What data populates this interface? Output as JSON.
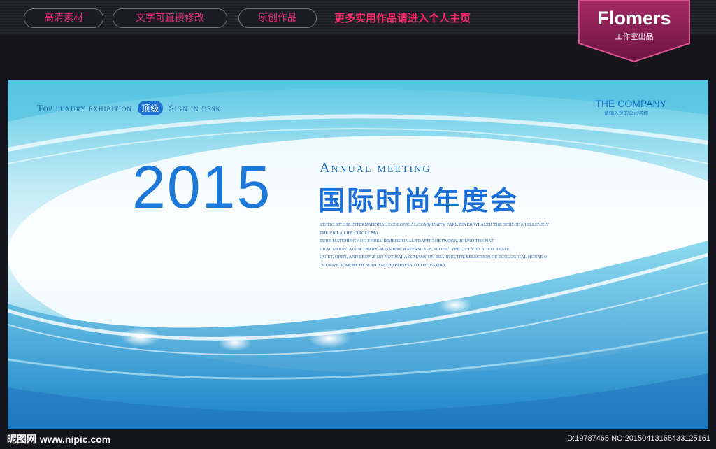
{
  "header": {
    "pills": [
      "高清素材",
      "文字可直接修改",
      "原创作品"
    ],
    "promo": "更多实用作品请进入个人主页",
    "badge_title": "Flomers",
    "badge_subtitle": "工作室出品"
  },
  "banner": {
    "tagline_left": "Top luxury exhibition",
    "tagline_tag": "顶级",
    "tagline_right": "Sign in desk",
    "company": "THE COMPANY",
    "company_sub": "请输入您的公司名称",
    "year": "2015",
    "annual": "Annual meeting",
    "cn_title": "国际时尚年度会",
    "body_lines": [
      "STATIC AT THE INTERNATIONAL ECOLOGICAL COMMUNITY PARK RIVER WEALTH THE SIDE OF A HILLENJOY",
      "THE VILLA LIFE CIRCLE MA",
      "TURE MATCHING AND THREE-DIMENSIONAL TRAFFIC NETWORK,ROUND THE NAT",
      "URAL MOUNTAIN SCENERY, SUNSHINE WATERSCAPE, SLOPE TYPE LIFT VILLA,TO CREATE",
      "QUIET, OPEN, AND PEOPLE DO NOT HARASS MANSION BEARING,THE SELECTION OF ECOLOGICAL HOUSE O",
      "CCUPANCY, MORE HEALTH AND HAPPINESS TO THE FAMILY."
    ]
  },
  "footer": {
    "watermark_cn": "昵图网",
    "watermark_site": "www.nipic.com",
    "image_id": "ID:19787465 NO:20150413165433125161"
  },
  "colors": {
    "accent_pink": "#e0307a",
    "brand_blue": "#1d78d8",
    "badge": "#8c1e55"
  }
}
